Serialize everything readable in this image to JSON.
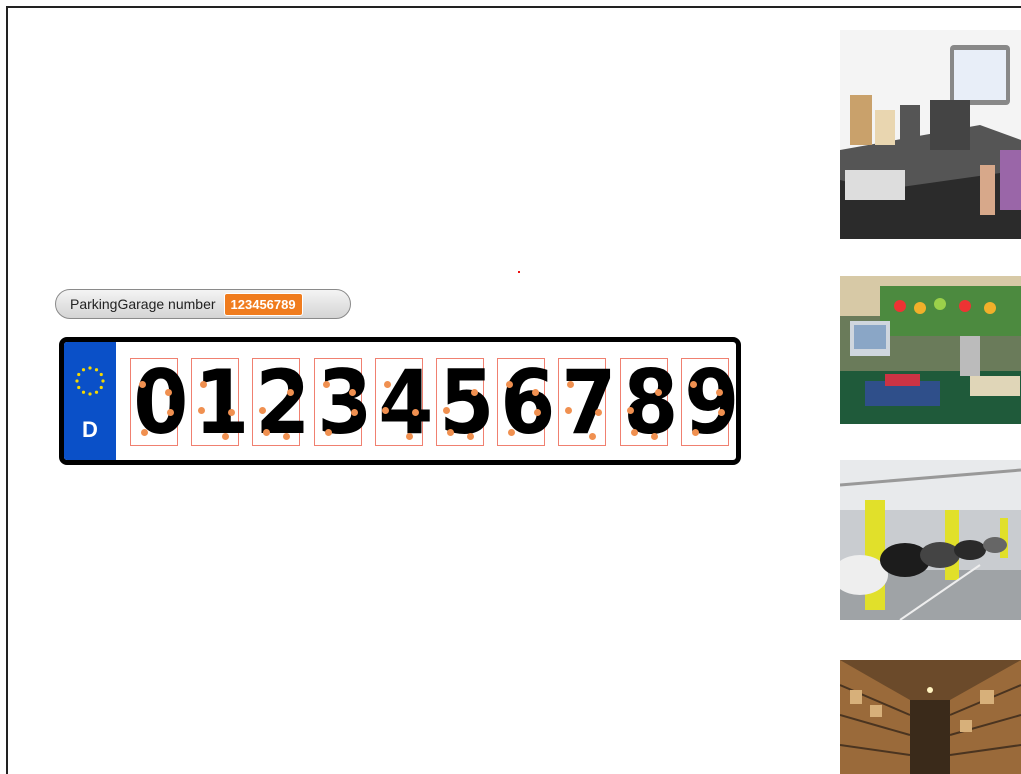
{
  "window": {
    "frame_color": "#222222"
  },
  "counter": {
    "label": "ParkingGarage number",
    "value": "123456789",
    "accent": "#f07c1e"
  },
  "plate": {
    "country_code": "D",
    "band_color": "#0a50c8",
    "digits": [
      "0",
      "1",
      "2",
      "3",
      "4",
      "5",
      "6",
      "7",
      "8",
      "9"
    ],
    "box_color": "#f08070",
    "dot_color": "#f09050"
  },
  "thumbnails": [
    {
      "name": "checkout-terminal-image"
    },
    {
      "name": "supermarket-scale-image"
    },
    {
      "name": "parking-garage-image"
    },
    {
      "name": "warehouse-shelves-image"
    }
  ]
}
